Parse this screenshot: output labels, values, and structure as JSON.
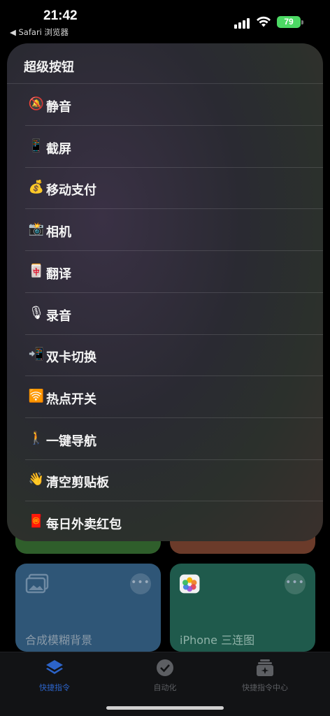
{
  "status_bar": {
    "time": "21:42",
    "back_label": "◀ Safari 浏览器",
    "battery": "79"
  },
  "menu": {
    "title": "超级按钮",
    "items": [
      {
        "emoji": "🔕",
        "label": "静音",
        "icon_name": "bell-muted-icon"
      },
      {
        "emoji": "📱",
        "label": "截屏",
        "icon_name": "phone-icon"
      },
      {
        "emoji": "💰",
        "label": "移动支付",
        "icon_name": "money-bag-icon"
      },
      {
        "emoji": "📸",
        "label": "相机",
        "icon_name": "camera-flash-icon"
      },
      {
        "emoji": "🀄",
        "label": "翻译",
        "icon_name": "mahjong-tile-icon"
      },
      {
        "emoji": "🎙",
        "label": "录音",
        "icon_name": "microphone-icon"
      },
      {
        "emoji": "📲",
        "label": "双卡切换",
        "icon_name": "phone-arrow-icon"
      },
      {
        "emoji": "🛜",
        "label": "热点开关",
        "icon_name": "wifi-icon"
      },
      {
        "emoji": "🚶",
        "label": "一键导航",
        "icon_name": "walking-person-icon"
      },
      {
        "emoji": "👋",
        "label": "清空剪贴板",
        "icon_name": "waving-hand-icon"
      },
      {
        "emoji": "🧧",
        "label": "每日外卖红包",
        "icon_name": "red-envelope-icon"
      }
    ]
  },
  "shortcuts": {
    "tile_blur_bg_label": "合成模糊背景",
    "tile_triple_label": "iPhone 三连图",
    "more_glyph": "•••"
  },
  "tab_bar": {
    "tabs": [
      {
        "label": "快捷指令",
        "active": true
      },
      {
        "label": "自动化",
        "active": false
      },
      {
        "label": "快捷指令中心",
        "active": false
      }
    ]
  },
  "colors": {
    "accent": "#2c63c8",
    "battery": "#4cd964"
  }
}
